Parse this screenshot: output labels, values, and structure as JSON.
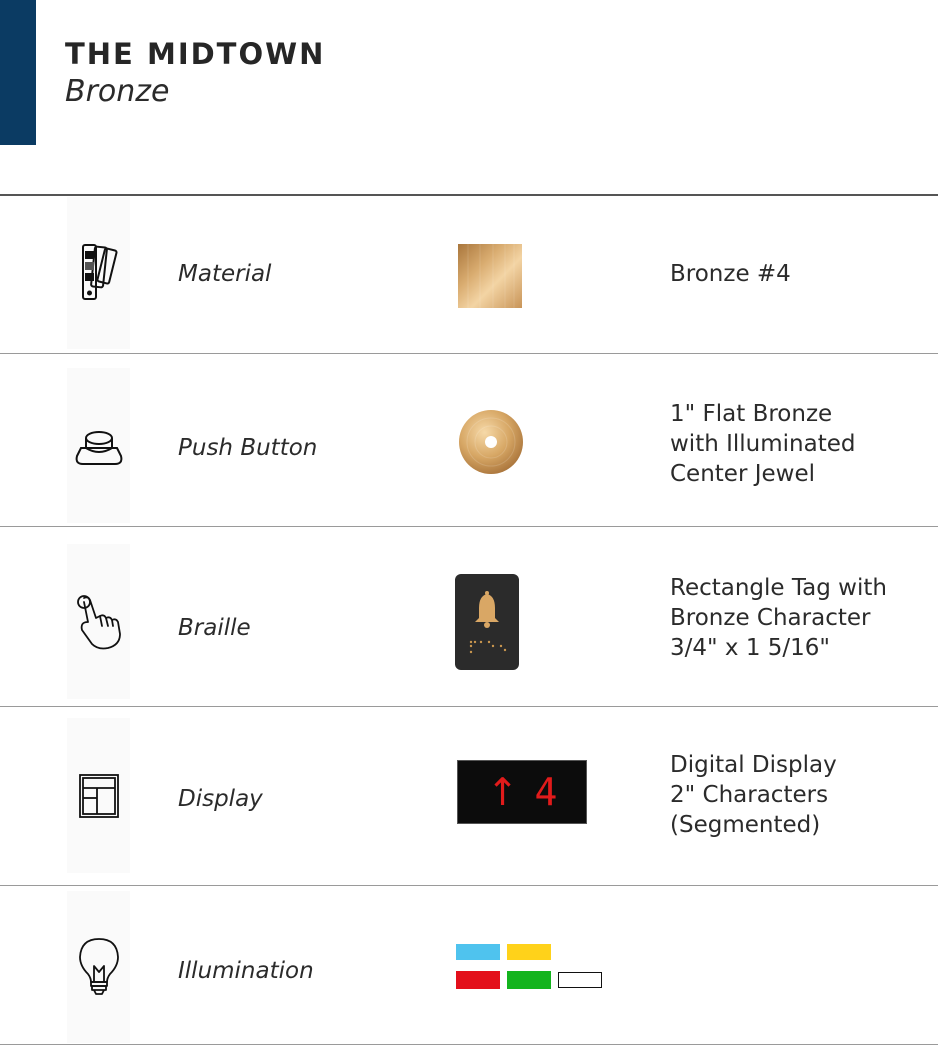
{
  "header": {
    "title": "THE MIDTOWN",
    "subtitle": "Bronze"
  },
  "colors": {
    "accent": "#0b3b63",
    "bronze_light": "#e9c48f",
    "bronze_dark": "#b07f45",
    "display_red": "#e11b1b"
  },
  "specs": [
    {
      "icon": "swatch-fan-icon",
      "label": "Material",
      "value_lines": [
        "Bronze #4"
      ]
    },
    {
      "icon": "push-button-icon",
      "label": "Push Button",
      "value_lines": [
        "1\" Flat Bronze",
        "with Illuminated",
        "Center Jewel"
      ]
    },
    {
      "icon": "touch-hand-icon",
      "label": "Braille",
      "value_lines": [
        "Rectangle Tag with",
        "Bronze Character",
        "3/4\" x 1 5/16\""
      ]
    },
    {
      "icon": "display-layout-icon",
      "label": "Display",
      "value_lines": [
        "Digital Display",
        "2\" Characters",
        "(Segmented)"
      ]
    },
    {
      "icon": "light-bulb-icon",
      "label": "Illumination",
      "value_lines": []
    }
  ],
  "display_sample": {
    "arrow": "↑",
    "digit": "4"
  },
  "illumination_colors": [
    "#4fc3ee",
    "#ffd21a",
    "#e3101b",
    "#14b41e",
    "#ffffff"
  ]
}
